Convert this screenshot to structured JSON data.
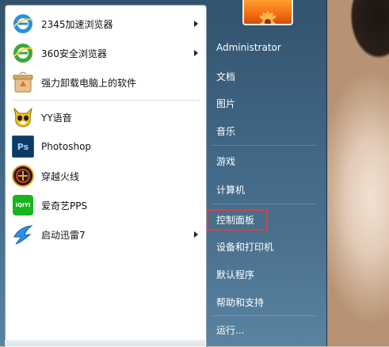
{
  "left_programs": [
    {
      "name": "program-2345-browser",
      "icon": "2345-browser-icon",
      "label": "2345加速浏览器",
      "has_submenu": true
    },
    {
      "name": "program-360-browser",
      "icon": "360-browser-icon",
      "label": "360安全浏览器",
      "has_submenu": true
    },
    {
      "name": "program-uninstaller",
      "icon": "uninstaller-icon",
      "label": "强力卸载电脑上的软件",
      "has_submenu": false
    },
    {
      "name": "program-yy",
      "icon": "yy-voice-icon",
      "label": "YY语音",
      "has_submenu": false
    },
    {
      "name": "program-photoshop",
      "icon": "photoshop-icon",
      "label": "Photoshop",
      "has_submenu": false
    },
    {
      "name": "program-crossfire",
      "icon": "crossfire-icon",
      "label": "穿越火线",
      "has_submenu": false
    },
    {
      "name": "program-iqiyi",
      "icon": "iqiyi-icon",
      "label": "爱奇艺PPS",
      "has_submenu": false
    },
    {
      "name": "program-xunlei",
      "icon": "xunlei-icon",
      "label": "启动迅雷7",
      "has_submenu": true
    }
  ],
  "icon_text": {
    "photoshop": "Ps",
    "iqiyi": "iQIYI"
  },
  "right_items": [
    {
      "name": "user-name",
      "label": "Administrator"
    },
    {
      "name": "documents-link",
      "label": "文档"
    },
    {
      "name": "pictures-link",
      "label": "图片"
    },
    {
      "name": "music-link",
      "label": "音乐"
    },
    {
      "name": "games-link",
      "label": "游戏"
    },
    {
      "name": "computer-link",
      "label": "计算机"
    },
    {
      "name": "control-panel-link",
      "label": "控制面板"
    },
    {
      "name": "devices-printers-link",
      "label": "设备和打印机"
    },
    {
      "name": "default-programs-link",
      "label": "默认程序"
    },
    {
      "name": "help-support-link",
      "label": "帮助和支持"
    },
    {
      "name": "run-link",
      "label": "运行..."
    }
  ],
  "colors": {
    "highlight_border": "#e53b3b",
    "menu_right_panel": "#3f6583"
  }
}
